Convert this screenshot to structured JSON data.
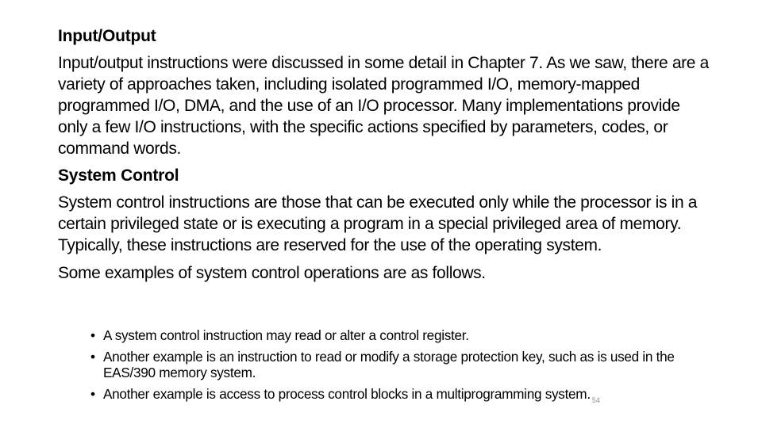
{
  "slide": {
    "sections": [
      {
        "heading": "Input/Output",
        "body": "Input/output instructions were discussed in some detail in Chapter 7. As we saw, there are a variety of approaches taken, including isolated programmed I/O, memory-mapped programmed I/O, DMA, and the use of an I/O processor. Many implementations provide only a few I/O instructions, with the specific actions specified by parameters, codes, or command words."
      },
      {
        "heading": "System Control",
        "body": "System control instructions are those that can be executed only while the processor is in a certain privileged state or is executing a program in a special privileged area of memory. Typically, these instructions are reserved for the use of the operating system."
      }
    ],
    "intro": "Some examples of system control operations are as follows.",
    "bullet_glyph": "•",
    "bullets": [
      "A system control instruction may read or alter a control register.",
      "Another example is an instruction to read or modify a storage protection key, such as is used in the EAS/390 memory system.",
      "Another example is access to process control blocks in a multiprogramming system."
    ],
    "page_number": "54"
  }
}
